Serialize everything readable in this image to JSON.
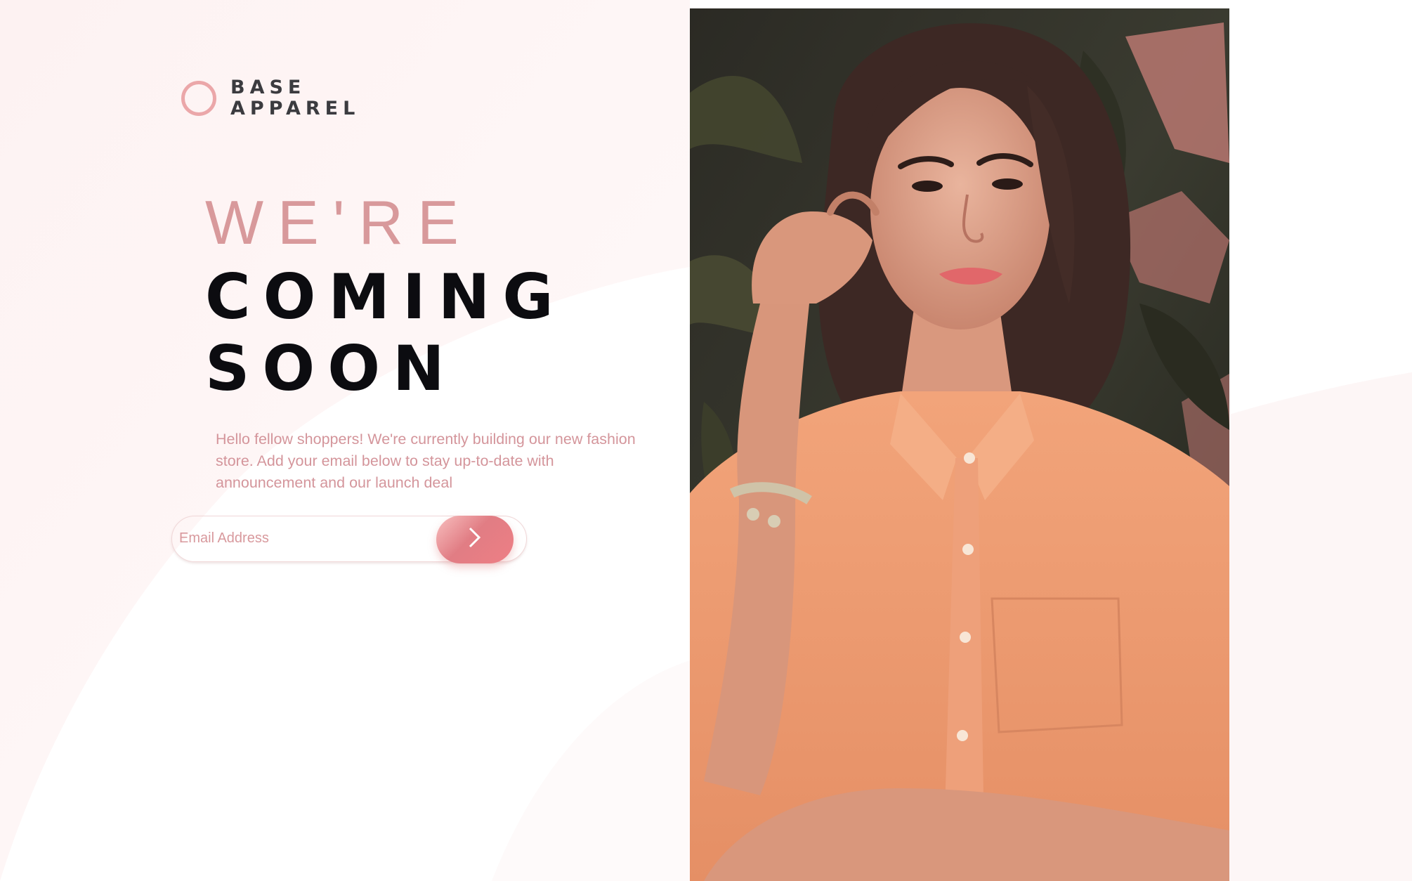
{
  "brand": {
    "line1": "BASE",
    "line2": "APPAREL"
  },
  "headline": {
    "light": "WE'RE",
    "bold_line1": "COMING",
    "bold_line2": "SOON"
  },
  "description": "Hello fellow shoppers! We're currently building our new fashion store. Add your email below to stay up-to-date with announcement and our launch deal",
  "form": {
    "email_placeholder": "Email Address",
    "email_value": ""
  },
  "icons": {
    "logo": "circle-logo-icon",
    "submit": "chevron-right-icon"
  },
  "colors": {
    "accent": "#ce9797",
    "accent_gradient_start": "#f8bfbf",
    "accent_gradient_end": "#ee8a8b",
    "heading_dark": "#0c0c10",
    "text_muted": "#d4959b"
  }
}
